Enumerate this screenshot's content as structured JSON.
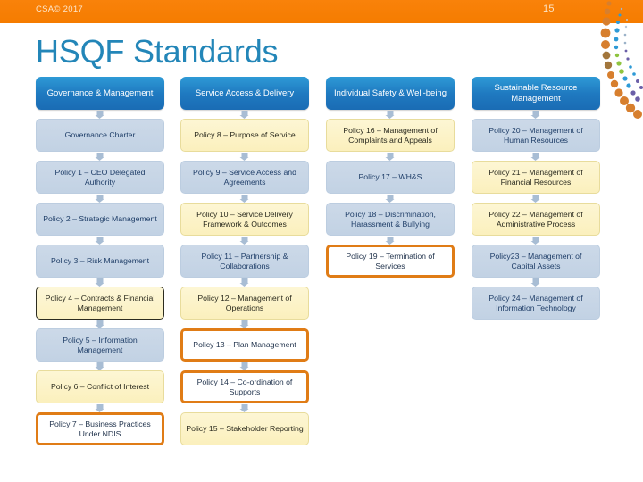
{
  "header": {
    "footer_label": "CSA© 2017",
    "page_number": "15",
    "bar_color": "#f57c00"
  },
  "title": "HSQF Standards",
  "title_color": "#2386b8",
  "columns": [
    {
      "header": "Governance & Management",
      "nodes": [
        {
          "label": "Governance Charter",
          "style": "blue"
        },
        {
          "label": "Policy 1 – CEO Delegated Authority",
          "style": "blue"
        },
        {
          "label": "Policy 2 – Strategic Management",
          "style": "blue"
        },
        {
          "label": "Policy 3 – Risk Management",
          "style": "blue"
        },
        {
          "label": "Policy 4 – Contracts & Financial Management",
          "style": "yellow-dark"
        },
        {
          "label": "Policy 5 – Information Management",
          "style": "blue"
        },
        {
          "label": "Policy 6 – Conflict of Interest",
          "style": "yellow"
        },
        {
          "label": "Policy 7 – Business Practices Under NDIS",
          "style": "white-orange"
        }
      ]
    },
    {
      "header": "Service Access & Delivery",
      "nodes": [
        {
          "label": "Policy 8 – Purpose of Service",
          "style": "yellow"
        },
        {
          "label": "Policy 9 – Service Access and Agreements",
          "style": "blue"
        },
        {
          "label": "Policy 10 – Service Delivery Framework & Outcomes",
          "style": "yellow"
        },
        {
          "label": "Policy 11 – Partnership & Collaborations",
          "style": "blue"
        },
        {
          "label": "Policy 12 – Management of Operations",
          "style": "yellow"
        },
        {
          "label": "Policy 13 – Plan Management",
          "style": "white-orange"
        },
        {
          "label": "Policy 14 – Co-ordination of Supports",
          "style": "white-orange"
        },
        {
          "label": "Policy 15 – Stakeholder Reporting",
          "style": "yellow"
        }
      ]
    },
    {
      "header": "Individual Safety & Well-being",
      "nodes": [
        {
          "label": "Policy 16 – Management of Complaints and Appeals",
          "style": "yellow"
        },
        {
          "label": "Policy 17 – WH&S",
          "style": "blue"
        },
        {
          "label": "Policy 18 – Discrimination, Harassment & Bullying",
          "style": "blue"
        },
        {
          "label": "Policy 19 – Termination of Services",
          "style": "white-orange"
        }
      ]
    },
    {
      "header": "Sustainable Resource Management",
      "nodes": [
        {
          "label": "Policy 20 – Management of Human Resources",
          "style": "blue"
        },
        {
          "label": "Policy 21 – Management of Financial Resources",
          "style": "yellow"
        },
        {
          "label": "Policy 22 – Management of Administrative Process",
          "style": "yellow"
        },
        {
          "label": "Policy23 – Management of Capital Assets",
          "style": "blue"
        },
        {
          "label": "Policy 24 – Management of Information Technology",
          "style": "blue"
        }
      ]
    }
  ],
  "decoration": {
    "name": "dot-arc",
    "colors": [
      "#d77f2e",
      "#2e9ad6",
      "#8fc43f",
      "#6b5fa8",
      "#1f79c0",
      "#a2763c"
    ]
  }
}
